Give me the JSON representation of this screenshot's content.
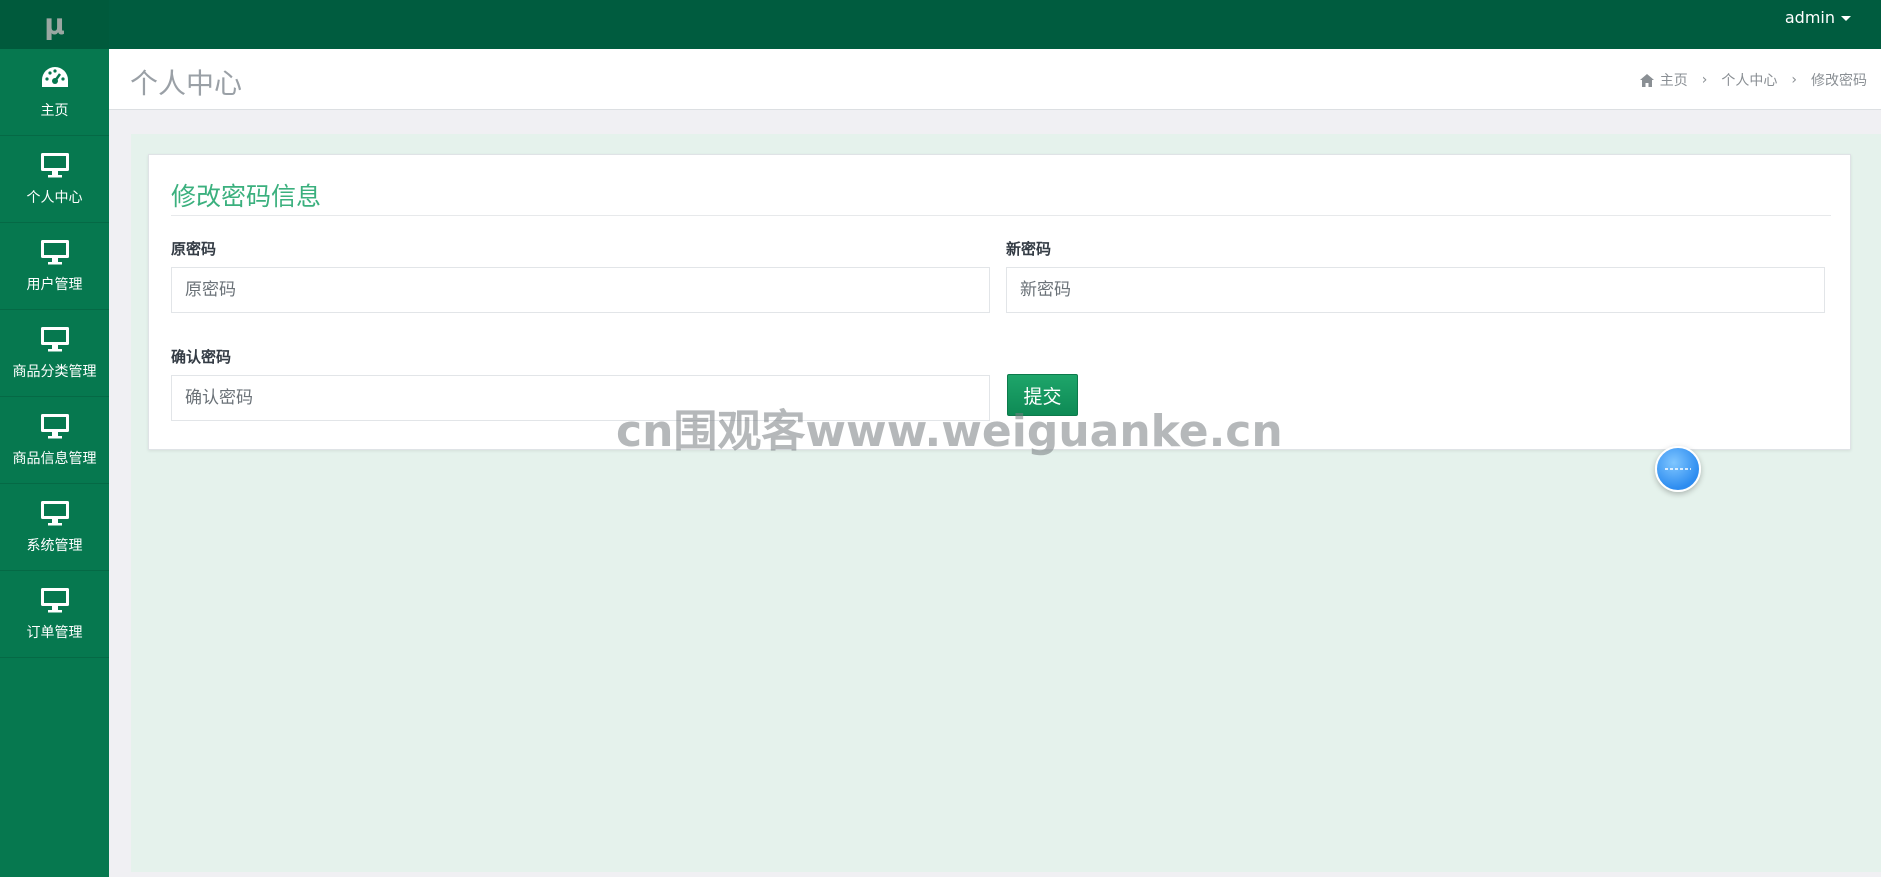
{
  "logo": {
    "text": "μ"
  },
  "topbar": {
    "user": "admin"
  },
  "sidebar": {
    "items": [
      {
        "label": "主页",
        "icon": "dashboard-icon"
      },
      {
        "label": "个人中心",
        "icon": "monitor-icon"
      },
      {
        "label": "用户管理",
        "icon": "monitor-icon"
      },
      {
        "label": "商品分类管理",
        "icon": "monitor-icon"
      },
      {
        "label": "商品信息管理",
        "icon": "monitor-icon"
      },
      {
        "label": "系统管理",
        "icon": "monitor-icon"
      },
      {
        "label": "订单管理",
        "icon": "monitor-icon"
      }
    ]
  },
  "header": {
    "title": "个人中心",
    "breadcrumb": [
      "主页",
      "个人中心",
      "修改密码"
    ]
  },
  "form": {
    "title": "修改密码信息",
    "old_password": {
      "label": "原密码",
      "placeholder": "原密码"
    },
    "new_password": {
      "label": "新密码",
      "placeholder": "新密码"
    },
    "confirm_password": {
      "label": "确认密码",
      "placeholder": "确认密码"
    },
    "submit_label": "提交"
  },
  "watermark": "cn围观客www.weiguanke.cn",
  "colors": {
    "sidebar": "#06784f",
    "topbar": "#005c3f",
    "accent": "#3bb07e",
    "content_bg": "#e5f2ec"
  }
}
